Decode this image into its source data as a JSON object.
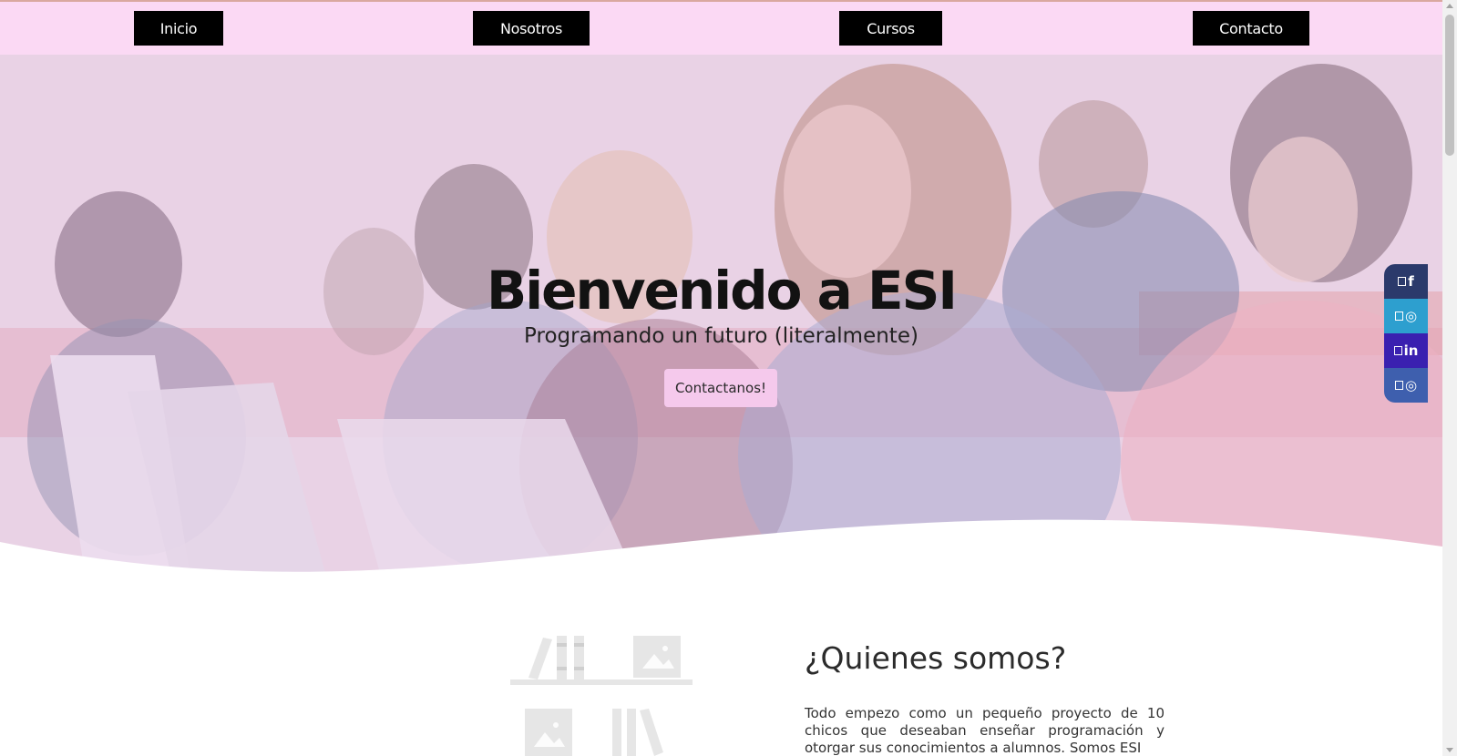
{
  "nav": {
    "items": [
      {
        "label": "Inicio"
      },
      {
        "label": "Nosotros"
      },
      {
        "label": "Cursos"
      },
      {
        "label": "Contacto"
      }
    ]
  },
  "hero": {
    "title": "Bienvenido a ESI",
    "subtitle": "Programando un futuro (literalmente)",
    "cta_label": "Contactanos!",
    "overlay_color": "#f4cdee"
  },
  "social": {
    "items": [
      {
        "icon": "facebook-icon",
        "glyph": "f",
        "color": "#2b3a6b"
      },
      {
        "icon": "instagram-icon",
        "glyph": "◎",
        "color": "#2d9fcf"
      },
      {
        "icon": "linkedin-icon",
        "glyph": "in",
        "color": "#3a20b0"
      },
      {
        "icon": "instagram-icon",
        "glyph": "◎",
        "color": "#3e5fae"
      }
    ]
  },
  "about": {
    "title": "¿Quienes somos?",
    "text": "Todo empezo como un pequeño proyecto de 10 chicos que deseaban enseñar programación y otorgar sus conocimientos a alumnos. Somos ESI"
  },
  "colors": {
    "nav_bg": "#fbd9f4",
    "nav_button_bg": "#000000",
    "cta_bg": "#f5c9ec"
  }
}
